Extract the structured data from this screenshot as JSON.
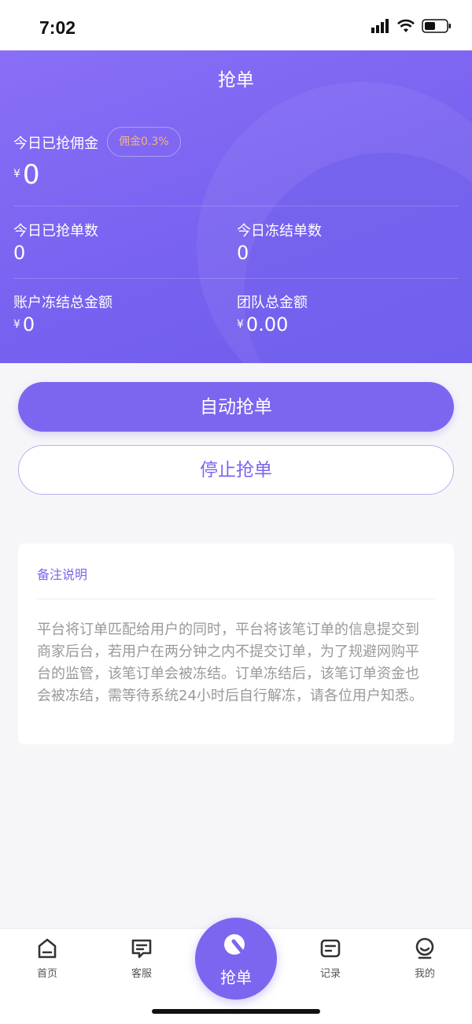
{
  "status_bar": {
    "time": "7:02"
  },
  "header": {
    "title": "抢单",
    "commission_label": "今日已抢佣金",
    "commission_badge": "佣金0.3%",
    "commission_currency": "¥",
    "commission_value": "0",
    "stats": {
      "grabbed_count_label": "今日已抢单数",
      "grabbed_count_value": "0",
      "frozen_count_label": "今日冻结单数",
      "frozen_count_value": "0",
      "frozen_amount_label": "账户冻结总金额",
      "frozen_amount_currency": "¥",
      "frozen_amount_value": "0",
      "team_amount_label": "团队总金额",
      "team_amount_currency": "¥",
      "team_amount_value": "0.00"
    }
  },
  "actions": {
    "auto_grab_label": "自动抢单",
    "stop_grab_label": "停止抢单"
  },
  "notes": {
    "title": "备注说明",
    "body": "平台将订单匹配给用户的同时，平台将该笔订单的信息提交到商家后台，若用户在两分钟之内不提交订单，为了规避网购平台的监管，该笔订单会被冻结。订单冻结后，该笔订单资金也会被冻结，需等待系统24小时后自行解冻，请各位用户知悉。"
  },
  "bottom_nav": {
    "items": [
      {
        "label": "首页",
        "icon": "home-icon"
      },
      {
        "label": "客服",
        "icon": "chat-icon"
      },
      {
        "label": "抢单",
        "icon": "grab-icon"
      },
      {
        "label": "记录",
        "icon": "record-icon"
      },
      {
        "label": "我的",
        "icon": "profile-icon"
      }
    ]
  },
  "colors": {
    "accent": "#7c66f0",
    "header_gradient_start": "#8a6ff6",
    "header_gradient_end": "#6e5cec",
    "badge_text": "#f2b37a"
  }
}
